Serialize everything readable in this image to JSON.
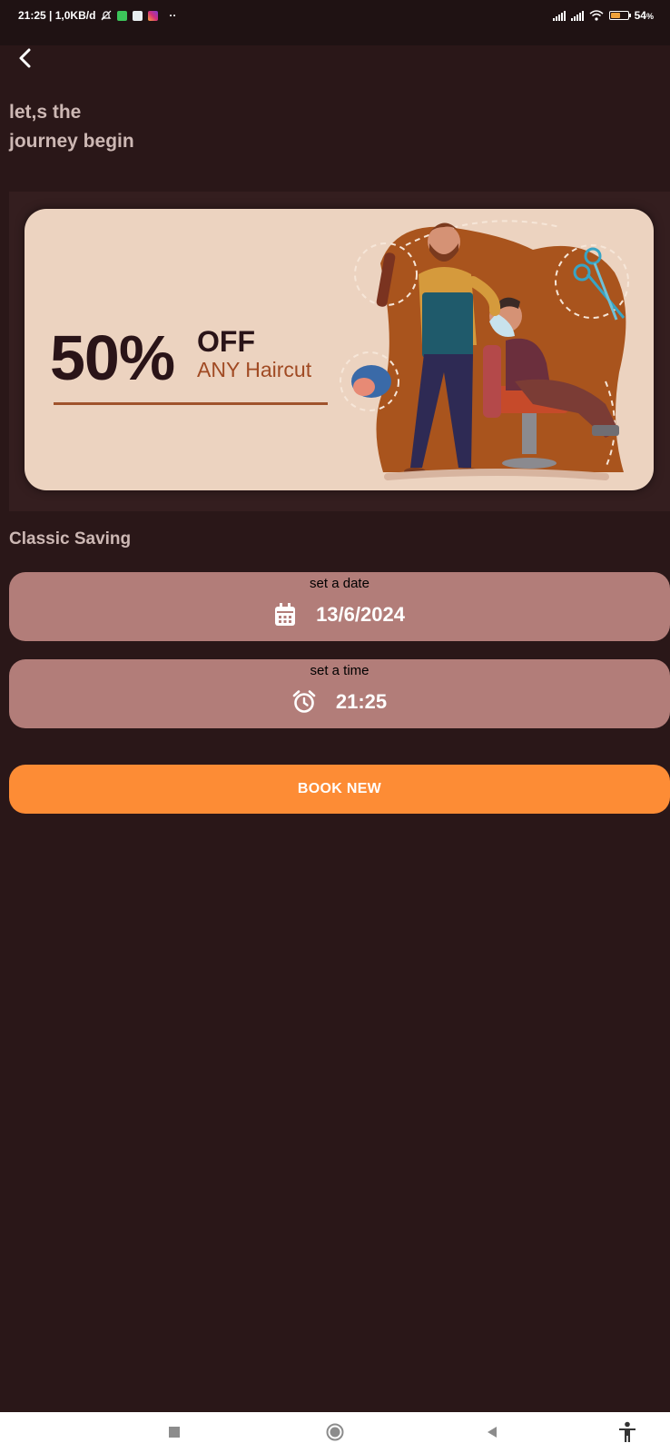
{
  "status_bar": {
    "time_speed": "21:25 | 1,0KB/d",
    "more": "··",
    "battery": "54",
    "battery_level": 0.54
  },
  "header": {
    "title_line1": "let,s the",
    "title_line2": "journey begin"
  },
  "banner": {
    "discount": "50%",
    "off": "OFF",
    "subtitle": "ANY Haircut"
  },
  "section": {
    "label": "Classic Saving"
  },
  "date_picker": {
    "caption": "set a date",
    "value": "13/6/2024",
    "icon": "calendar-icon"
  },
  "time_picker": {
    "caption": "set a time",
    "value": "21:25",
    "icon": "alarm-clock-icon"
  },
  "book_button": {
    "label": "BOOK NEW",
    "color": "#fd8c35"
  },
  "colors": {
    "background": "#2a1718",
    "picker": "#b27d79",
    "accent": "#fd8c35"
  }
}
